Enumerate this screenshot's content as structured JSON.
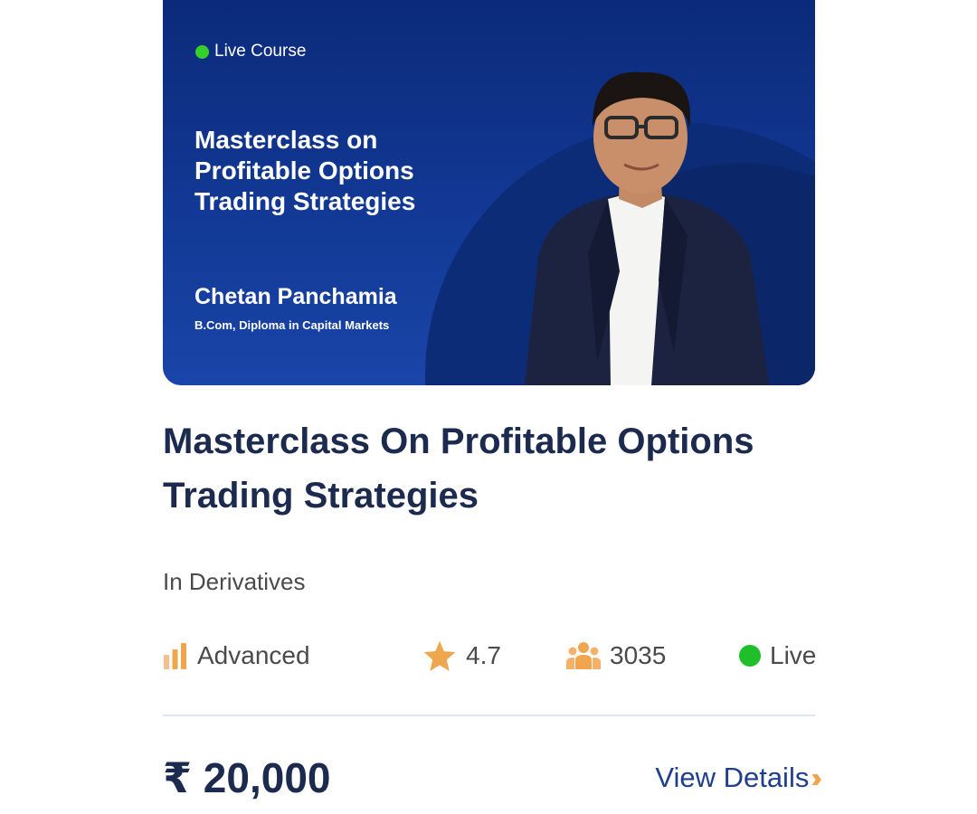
{
  "banner": {
    "live_label": "Live Course",
    "title": "Masterclass on Profitable Options Trading Strategies",
    "presenter_name": "Chetan Panchamia",
    "presenter_credentials": "B.Com, Diploma in Capital Markets"
  },
  "course": {
    "title": "Masterclass On Profitable Options Trading Strategies",
    "category": "In Derivatives",
    "level": "Advanced",
    "rating": "4.7",
    "learners": "3035",
    "status": "Live",
    "price": "₹ 20,000",
    "view_details_label": "View Details"
  },
  "colors": {
    "banner_bg": "#123a97",
    "title": "#1b2a4e",
    "accent_orange": "#f0a54f",
    "live_green": "#1fbf2a",
    "link": "#1f3f8c"
  },
  "icons": {
    "level": "bar-chart-icon",
    "rating": "star-icon",
    "learners": "people-group-icon",
    "status": "live-dot-icon",
    "view_details": "double-chevron-right-icon"
  }
}
